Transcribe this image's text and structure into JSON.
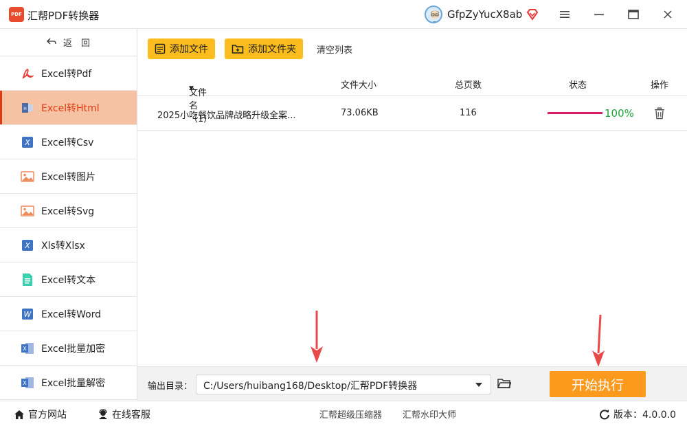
{
  "app": {
    "logo_text": "PDF",
    "title": "汇帮PDF转换器"
  },
  "user": {
    "name": "GfpZyYucX8ab"
  },
  "sidebar": {
    "back_label": "返　回",
    "items": [
      {
        "label": "Excel转Pdf",
        "icon": "pdf-icon"
      },
      {
        "label": "Excel转Html",
        "icon": "html-icon",
        "active": true
      },
      {
        "label": "Excel转Csv",
        "icon": "excel-icon"
      },
      {
        "label": "Excel转图片",
        "icon": "image-icon"
      },
      {
        "label": "Excel转Svg",
        "icon": "image-icon"
      },
      {
        "label": "Xls转Xlsx",
        "icon": "excel-icon"
      },
      {
        "label": "Excel转文本",
        "icon": "text-file-icon"
      },
      {
        "label": "Excel转Word",
        "icon": "word-icon"
      },
      {
        "label": "Excel批量加密",
        "icon": "excel-lock-icon"
      },
      {
        "label": "Excel批量解密",
        "icon": "excel-unlock-icon"
      }
    ]
  },
  "toolbar": {
    "add_file": "添加文件",
    "add_folder": "添加文件夹",
    "clear_list": "清空列表"
  },
  "table": {
    "headers": {
      "filename": "文件名（1）",
      "size": "文件大小",
      "pages": "总页数",
      "status": "状态",
      "action": "操作"
    },
    "rows": [
      {
        "filename": "2025小吃餐饮品牌战略升级全案...",
        "size": "73.06KB",
        "pages": "116",
        "progress": "100%"
      }
    ]
  },
  "output": {
    "label": "输出目录：",
    "path": "C:/Users/huibang168/Desktop/汇帮PDF转换器",
    "start_button": "开始执行"
  },
  "footer": {
    "website": "官方网站",
    "support": "在线客服",
    "link1": "汇帮超级压缩器",
    "link2": "汇帮水印大师",
    "version": "版本：4.0.0.0"
  },
  "colors": {
    "accent_yellow": "#fbbd1d",
    "start_orange": "#fb9a1c",
    "active_bg": "#f5c2a3",
    "active_text": "#e03c14",
    "progress": "#d81b60",
    "progress_text": "#1aa336"
  }
}
